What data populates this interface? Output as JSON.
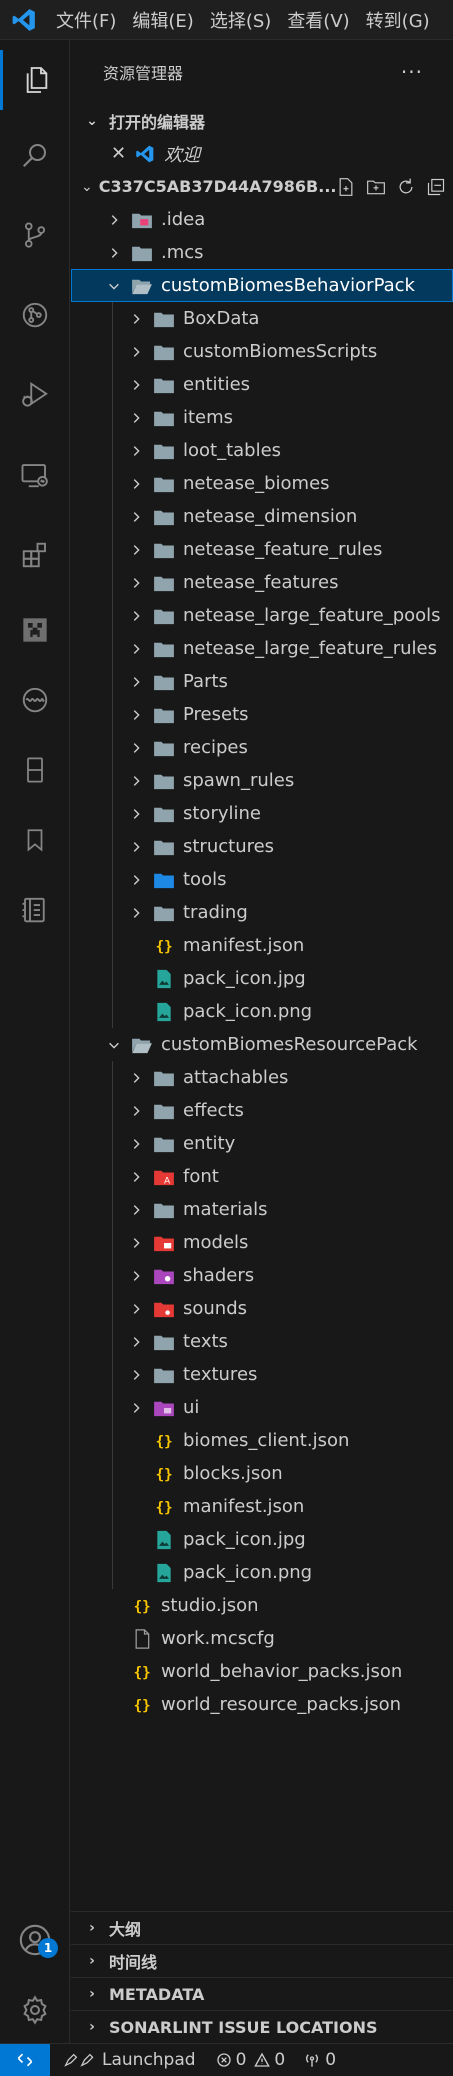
{
  "menubar": {
    "items": [
      "文件(F)",
      "编辑(E)",
      "选择(S)",
      "查看(V)",
      "转到(G)"
    ]
  },
  "explorer": {
    "title": "资源管理器",
    "more": "···",
    "open_editors": {
      "title": "打开的编辑器",
      "items": [
        {
          "label": "欢迎"
        }
      ]
    },
    "root": {
      "label": "C337C5AB37D44A7986B..."
    },
    "tree": [
      {
        "label": ".idea",
        "depth": 1,
        "kind": "folder-special",
        "expanded": false
      },
      {
        "label": ".mcs",
        "depth": 1,
        "kind": "folder",
        "expanded": false
      },
      {
        "label": "customBiomesBehaviorPack",
        "depth": 1,
        "kind": "folder-open",
        "expanded": true,
        "selected": true
      },
      {
        "label": "BoxData",
        "depth": 2,
        "kind": "folder",
        "expanded": false
      },
      {
        "label": "customBiomesScripts",
        "depth": 2,
        "kind": "folder",
        "expanded": false
      },
      {
        "label": "entities",
        "depth": 2,
        "kind": "folder",
        "expanded": false
      },
      {
        "label": "items",
        "depth": 2,
        "kind": "folder",
        "expanded": false
      },
      {
        "label": "loot_tables",
        "depth": 2,
        "kind": "folder",
        "expanded": false
      },
      {
        "label": "netease_biomes",
        "depth": 2,
        "kind": "folder",
        "expanded": false
      },
      {
        "label": "netease_dimension",
        "depth": 2,
        "kind": "folder",
        "expanded": false
      },
      {
        "label": "netease_feature_rules",
        "depth": 2,
        "kind": "folder",
        "expanded": false
      },
      {
        "label": "netease_features",
        "depth": 2,
        "kind": "folder",
        "expanded": false
      },
      {
        "label": "netease_large_feature_pools",
        "depth": 2,
        "kind": "folder",
        "expanded": false
      },
      {
        "label": "netease_large_feature_rules",
        "depth": 2,
        "kind": "folder",
        "expanded": false
      },
      {
        "label": "Parts",
        "depth": 2,
        "kind": "folder",
        "expanded": false
      },
      {
        "label": "Presets",
        "depth": 2,
        "kind": "folder",
        "expanded": false
      },
      {
        "label": "recipes",
        "depth": 2,
        "kind": "folder",
        "expanded": false
      },
      {
        "label": "spawn_rules",
        "depth": 2,
        "kind": "folder",
        "expanded": false
      },
      {
        "label": "storyline",
        "depth": 2,
        "kind": "folder",
        "expanded": false
      },
      {
        "label": "structures",
        "depth": 2,
        "kind": "folder",
        "expanded": false
      },
      {
        "label": "tools",
        "depth": 2,
        "kind": "folder-tools",
        "expanded": false
      },
      {
        "label": "trading",
        "depth": 2,
        "kind": "folder",
        "expanded": false
      },
      {
        "label": "manifest.json",
        "depth": 2,
        "kind": "json"
      },
      {
        "label": "pack_icon.jpg",
        "depth": 2,
        "kind": "image"
      },
      {
        "label": "pack_icon.png",
        "depth": 2,
        "kind": "image"
      },
      {
        "label": "customBiomesResourcePack",
        "depth": 1,
        "kind": "folder-open",
        "expanded": true
      },
      {
        "label": "attachables",
        "depth": 2,
        "kind": "folder",
        "expanded": false
      },
      {
        "label": "effects",
        "depth": 2,
        "kind": "folder",
        "expanded": false
      },
      {
        "label": "entity",
        "depth": 2,
        "kind": "folder",
        "expanded": false
      },
      {
        "label": "font",
        "depth": 2,
        "kind": "folder-font",
        "expanded": false
      },
      {
        "label": "materials",
        "depth": 2,
        "kind": "folder",
        "expanded": false
      },
      {
        "label": "models",
        "depth": 2,
        "kind": "folder-models",
        "expanded": false
      },
      {
        "label": "shaders",
        "depth": 2,
        "kind": "folder-shaders",
        "expanded": false
      },
      {
        "label": "sounds",
        "depth": 2,
        "kind": "folder-sounds",
        "expanded": false
      },
      {
        "label": "texts",
        "depth": 2,
        "kind": "folder",
        "expanded": false
      },
      {
        "label": "textures",
        "depth": 2,
        "kind": "folder",
        "expanded": false
      },
      {
        "label": "ui",
        "depth": 2,
        "kind": "folder-ui",
        "expanded": false
      },
      {
        "label": "biomes_client.json",
        "depth": 2,
        "kind": "json"
      },
      {
        "label": "blocks.json",
        "depth": 2,
        "kind": "json"
      },
      {
        "label": "manifest.json",
        "depth": 2,
        "kind": "json"
      },
      {
        "label": "pack_icon.jpg",
        "depth": 2,
        "kind": "image"
      },
      {
        "label": "pack_icon.png",
        "depth": 2,
        "kind": "image"
      },
      {
        "label": "studio.json",
        "depth": 1,
        "kind": "json"
      },
      {
        "label": "work.mcscfg",
        "depth": 1,
        "kind": "file"
      },
      {
        "label": "world_behavior_packs.json",
        "depth": 1,
        "kind": "json"
      },
      {
        "label": "world_resource_packs.json",
        "depth": 1,
        "kind": "json"
      }
    ],
    "bottom_sections": [
      "大纲",
      "时间线",
      "METADATA",
      "SONARLINT ISSUE LOCATIONS"
    ]
  },
  "activity_bar": {
    "account_badge": "1"
  },
  "statusbar": {
    "launchpad": "Launchpad",
    "errors": "0",
    "warnings": "0",
    "ports": "0"
  },
  "colors": {
    "accent": "#0078d4",
    "folder": "#90a4ae",
    "json": "#f9c700",
    "image": "#26a69a"
  }
}
